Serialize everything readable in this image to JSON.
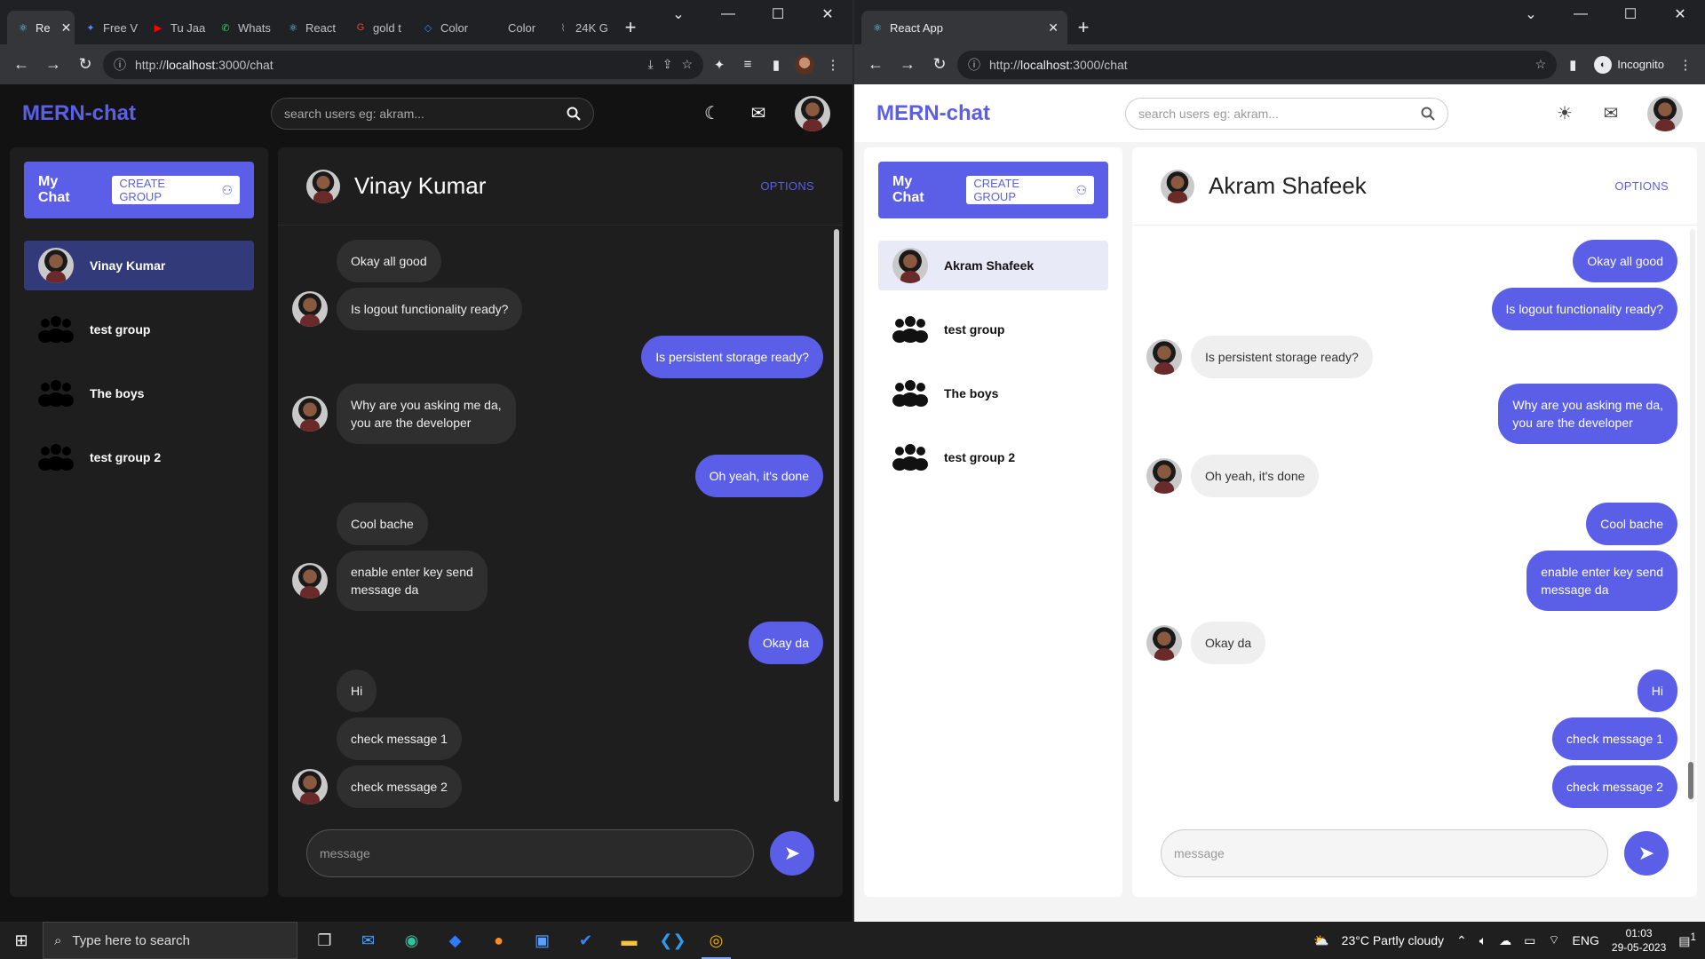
{
  "left_window": {
    "tabs": [
      {
        "label": "Re",
        "active": true,
        "icon": "react-icon"
      },
      {
        "label": "Free V",
        "icon": "globe-icon"
      },
      {
        "label": "Tu Jaa",
        "icon": "youtube-icon"
      },
      {
        "label": "Whats",
        "icon": "whatsapp-icon"
      },
      {
        "label": "React",
        "icon": "react-icon"
      },
      {
        "label": "gold t",
        "icon": "google-icon"
      },
      {
        "label": "Color",
        "icon": "code-icon"
      },
      {
        "label": "Color",
        "icon": "blank-icon"
      },
      {
        "label": "24K G",
        "icon": "chart-icon"
      }
    ],
    "url_prefix": "http://",
    "url_host": "localhost",
    "url_rest": ":3000/chat"
  },
  "right_window": {
    "tabs": [
      {
        "label": "React App",
        "active": true,
        "icon": "react-icon"
      }
    ],
    "url_prefix": "http://",
    "url_host": "localhost",
    "url_rest": ":3000/chat",
    "incognito_label": "Incognito"
  },
  "app": {
    "brand": "MERN-chat",
    "search_placeholder": "search users eg: akram...",
    "my_chat_label": "My Chat",
    "create_group_label": "CREATE GROUP",
    "options_label": "OPTIONS",
    "message_placeholder": "message",
    "accent_color": "#5b5fe8"
  },
  "dark_view": {
    "theme": "dark",
    "chat_list": [
      {
        "name": "Vinay Kumar",
        "type": "user",
        "selected": true
      },
      {
        "name": "test group",
        "type": "group"
      },
      {
        "name": "The boys",
        "type": "group"
      },
      {
        "name": "test group 2",
        "type": "group"
      }
    ],
    "active_chat_name": "Vinay Kumar",
    "messages": [
      {
        "text": "Okay all good",
        "mine": false,
        "avatar": false
      },
      {
        "text": "Is logout functionality ready?",
        "mine": false,
        "avatar": true
      },
      {
        "text": "Is persistent storage ready?",
        "mine": true
      },
      {
        "text": "Why are you asking me da,\nyou are the developer",
        "mine": false,
        "avatar": true
      },
      {
        "text": "Oh yeah, it's done",
        "mine": true
      },
      {
        "text": "Cool bache",
        "mine": false,
        "avatar": false
      },
      {
        "text": "enable enter key send\nmessage da",
        "mine": false,
        "avatar": true
      },
      {
        "text": "Okay da",
        "mine": true
      },
      {
        "text": "Hi",
        "mine": false,
        "avatar": false
      },
      {
        "text": "check message 1",
        "mine": false,
        "avatar": false
      },
      {
        "text": "check message 2",
        "mine": false,
        "avatar": true
      }
    ]
  },
  "light_view": {
    "theme": "light",
    "chat_list": [
      {
        "name": "Akram Shafeek",
        "type": "user",
        "selected": true
      },
      {
        "name": "test group",
        "type": "group"
      },
      {
        "name": "The boys",
        "type": "group"
      },
      {
        "name": "test group 2",
        "type": "group"
      }
    ],
    "active_chat_name": "Akram Shafeek",
    "messages": [
      {
        "text": "Okay all good",
        "mine": true
      },
      {
        "text": "Is logout functionality ready?",
        "mine": true
      },
      {
        "text": "Is persistent storage ready?",
        "mine": false,
        "avatar": true
      },
      {
        "text": "Why are you asking me da,\nyou are the developer",
        "mine": true
      },
      {
        "text": "Oh yeah, it's done",
        "mine": false,
        "avatar": true
      },
      {
        "text": "Cool bache",
        "mine": true
      },
      {
        "text": "enable enter key send\nmessage da",
        "mine": true
      },
      {
        "text": "Okay da",
        "mine": false,
        "avatar": true
      },
      {
        "text": "Hi",
        "mine": true
      },
      {
        "text": "check message 1",
        "mine": true
      },
      {
        "text": "check message 2",
        "mine": true
      }
    ]
  },
  "taskbar": {
    "search_placeholder": "Type here to search",
    "weather": "23°C  Partly cloudy",
    "language": "ENG",
    "time": "01:03",
    "date": "29-05-2023",
    "notification_count": "1"
  }
}
